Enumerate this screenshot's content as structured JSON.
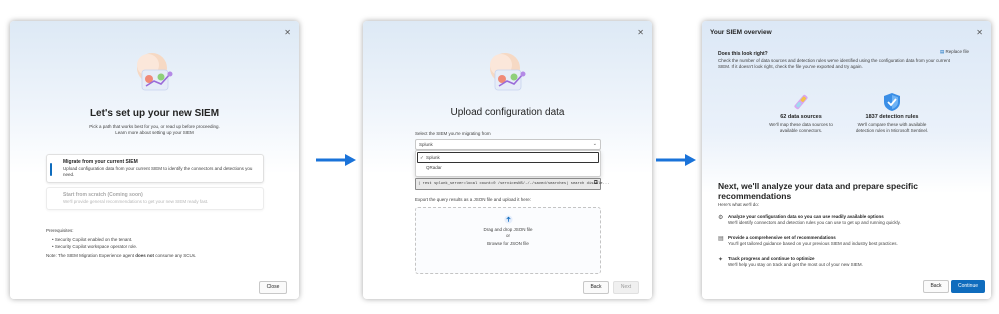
{
  "panel1": {
    "title": "Let's set up your new SIEM",
    "subtitle": "Pick a path that works best for you, or read up before proceeding.",
    "learn_link": "Learn more about setting up your SIEM",
    "option1": {
      "title": "Migrate from your current SIEM",
      "desc": "Upload configuration data from your current SIEM to identify the connectors and detections you need."
    },
    "option2": {
      "title": "Start from scratch (Coming soon)",
      "desc": "We'll provide general recommendations to get your new SIEM ready fast."
    },
    "prereq_label": "Prerequisites:",
    "prereqs": [
      "Security Copilot enabled on the tenant.",
      "Security Copilot workspace operator role."
    ],
    "note_prefix": "Note: The SIEM Migration Experience agent ",
    "note_bold": "does not",
    "note_suffix": " consume any SCUs.",
    "close_label": "Close"
  },
  "panel2": {
    "title": "Upload configuration data",
    "select_label": "Select the SIEM you're migrating from",
    "selected_value": "Splunk",
    "options": [
      "Splunk",
      "QRadar"
    ],
    "query": "| rest splunk_server=local count=0 /servicesNS/-/-/saved/searches| search disable...",
    "export_label": "Export the query results as a JSON file and upload it here:",
    "drop_text": "Drag and drop JSON file",
    "or_text": "or",
    "browse_link": "Browse for JSON file",
    "back_label": "Back",
    "next_label": "Next"
  },
  "panel3": {
    "header": "Your SIEM overview",
    "question": "Does this look right?",
    "replace_label": "Replace file",
    "intro": "Check the number of data sources and detection rules we've identified using the configuration data from your current SIEM. If it doesn't look right, check the file you've exported and try again.",
    "stat1": {
      "value": "62 data sources",
      "desc": "We'll map these data sources to available connectors."
    },
    "stat2": {
      "value": "1837 detection rules",
      "desc": "We'll compare these with available detection rules in Microsoft Sentinel."
    },
    "next_title": "Next, we'll analyze your data and prepare specific recommendations",
    "whats_next": "Here's what we'll do:",
    "steps": [
      {
        "title": "Analyze your configuration data so you can use readily available options",
        "desc": "We'll identify connectors and detection rules you can use to get up and running quickly."
      },
      {
        "title": "Provide a comprehensive set of recommendations",
        "desc": "You'll get tailored guidance based on your previous SIEM and industry best practices."
      },
      {
        "title": "Track progress and continue to optimize",
        "desc": "We'll help you stay on track and get the most out of your new SIEM."
      }
    ],
    "back_label": "Back",
    "continue_label": "Continue"
  },
  "colors": {
    "accent": "#0f6cbd",
    "arrow": "#1a73d9"
  }
}
